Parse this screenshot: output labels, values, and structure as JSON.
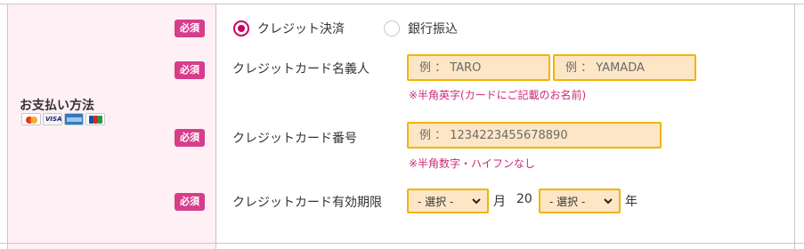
{
  "payment": {
    "section_label": "お支払い方法",
    "required_badge": "必須",
    "card_brands": [
      "mastercard-icon",
      "visa-icon",
      "amex-icon",
      "jcb-icon"
    ],
    "visa_text": "VISA",
    "methods": [
      {
        "label": "クレジット決済",
        "selected": true
      },
      {
        "label": "銀行振込",
        "selected": false
      }
    ],
    "cardholder": {
      "label": "クレジットカード名義人",
      "first_placeholder": "例 ： TARO",
      "last_placeholder": "例 ： YAMADA",
      "note": "※半角英字(カードにご記載のお名前)"
    },
    "card_number": {
      "label": "クレジットカード番号",
      "placeholder": "例 ： 1234223455678890",
      "note": "※半角数字・ハイフンなし"
    },
    "expiry": {
      "label": "クレジットカード有効期限",
      "month_select": "- 選択 -",
      "month_unit": "月",
      "year_prefix": "20",
      "year_select": "- 選択 -",
      "year_unit": "年"
    }
  },
  "colors": {
    "accent": "#c8005f",
    "badge": "#d63d8b",
    "input_bg": "#fde6c6",
    "input_border": "#f0b500",
    "left_bg": "#fff0f5",
    "note": "#cc2a7a"
  }
}
